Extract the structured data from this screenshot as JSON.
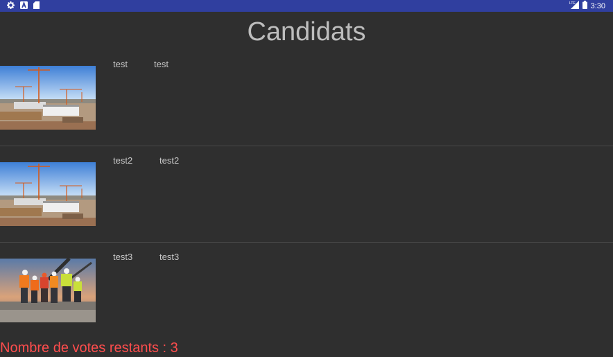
{
  "status_bar": {
    "time": "3:30",
    "network": "LTE",
    "icons": [
      "gear-icon",
      "a-icon",
      "sd-card-icon",
      "signal-icon",
      "battery-icon"
    ]
  },
  "header": {
    "title": "Candidats"
  },
  "candidates": [
    {
      "first": "test",
      "last": "test",
      "image": "construction-site"
    },
    {
      "first": "test2",
      "last": "test2",
      "image": "construction-site"
    },
    {
      "first": "test3",
      "last": "test3",
      "image": "construction-workers"
    }
  ],
  "footer": {
    "votes_text": "Nombre de votes restants : 3"
  },
  "colors": {
    "status_bar": "#303f9f",
    "background": "#2f2f2f",
    "votes_text": "#ff4d4d"
  }
}
